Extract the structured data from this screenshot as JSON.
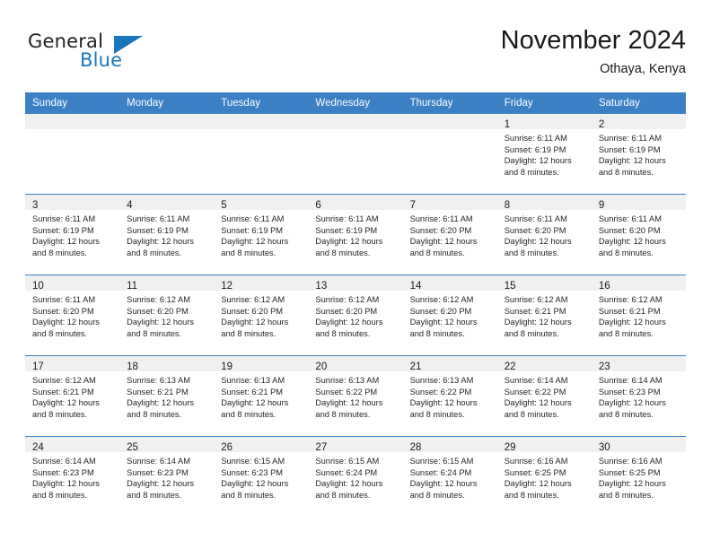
{
  "brand": {
    "name_part1": "General",
    "name_part2": "Blue",
    "triangle_color": "#1b75bb",
    "text_color": "#231f20"
  },
  "header": {
    "title": "November 2024",
    "subtitle": "Othaya, Kenya"
  },
  "colors": {
    "header_bar": "#3b7fc4",
    "daynum_band": "#f0f0f0",
    "grid_line": "#3b7fc4",
    "text": "#1a1a1a"
  },
  "weekday_headers": [
    "Sunday",
    "Monday",
    "Tuesday",
    "Wednesday",
    "Thursday",
    "Friday",
    "Saturday"
  ],
  "weeks": [
    [
      {
        "day": "",
        "empty": true
      },
      {
        "day": "",
        "empty": true
      },
      {
        "day": "",
        "empty": true
      },
      {
        "day": "",
        "empty": true
      },
      {
        "day": "",
        "empty": true
      },
      {
        "day": "1",
        "sunrise": "Sunrise: 6:11 AM",
        "sunset": "Sunset: 6:19 PM",
        "daylight1": "Daylight: 12 hours",
        "daylight2": "and 8 minutes."
      },
      {
        "day": "2",
        "sunrise": "Sunrise: 6:11 AM",
        "sunset": "Sunset: 6:19 PM",
        "daylight1": "Daylight: 12 hours",
        "daylight2": "and 8 minutes."
      }
    ],
    [
      {
        "day": "3",
        "sunrise": "Sunrise: 6:11 AM",
        "sunset": "Sunset: 6:19 PM",
        "daylight1": "Daylight: 12 hours",
        "daylight2": "and 8 minutes."
      },
      {
        "day": "4",
        "sunrise": "Sunrise: 6:11 AM",
        "sunset": "Sunset: 6:19 PM",
        "daylight1": "Daylight: 12 hours",
        "daylight2": "and 8 minutes."
      },
      {
        "day": "5",
        "sunrise": "Sunrise: 6:11 AM",
        "sunset": "Sunset: 6:19 PM",
        "daylight1": "Daylight: 12 hours",
        "daylight2": "and 8 minutes."
      },
      {
        "day": "6",
        "sunrise": "Sunrise: 6:11 AM",
        "sunset": "Sunset: 6:19 PM",
        "daylight1": "Daylight: 12 hours",
        "daylight2": "and 8 minutes."
      },
      {
        "day": "7",
        "sunrise": "Sunrise: 6:11 AM",
        "sunset": "Sunset: 6:20 PM",
        "daylight1": "Daylight: 12 hours",
        "daylight2": "and 8 minutes."
      },
      {
        "day": "8",
        "sunrise": "Sunrise: 6:11 AM",
        "sunset": "Sunset: 6:20 PM",
        "daylight1": "Daylight: 12 hours",
        "daylight2": "and 8 minutes."
      },
      {
        "day": "9",
        "sunrise": "Sunrise: 6:11 AM",
        "sunset": "Sunset: 6:20 PM",
        "daylight1": "Daylight: 12 hours",
        "daylight2": "and 8 minutes."
      }
    ],
    [
      {
        "day": "10",
        "sunrise": "Sunrise: 6:11 AM",
        "sunset": "Sunset: 6:20 PM",
        "daylight1": "Daylight: 12 hours",
        "daylight2": "and 8 minutes."
      },
      {
        "day": "11",
        "sunrise": "Sunrise: 6:12 AM",
        "sunset": "Sunset: 6:20 PM",
        "daylight1": "Daylight: 12 hours",
        "daylight2": "and 8 minutes."
      },
      {
        "day": "12",
        "sunrise": "Sunrise: 6:12 AM",
        "sunset": "Sunset: 6:20 PM",
        "daylight1": "Daylight: 12 hours",
        "daylight2": "and 8 minutes."
      },
      {
        "day": "13",
        "sunrise": "Sunrise: 6:12 AM",
        "sunset": "Sunset: 6:20 PM",
        "daylight1": "Daylight: 12 hours",
        "daylight2": "and 8 minutes."
      },
      {
        "day": "14",
        "sunrise": "Sunrise: 6:12 AM",
        "sunset": "Sunset: 6:20 PM",
        "daylight1": "Daylight: 12 hours",
        "daylight2": "and 8 minutes."
      },
      {
        "day": "15",
        "sunrise": "Sunrise: 6:12 AM",
        "sunset": "Sunset: 6:21 PM",
        "daylight1": "Daylight: 12 hours",
        "daylight2": "and 8 minutes."
      },
      {
        "day": "16",
        "sunrise": "Sunrise: 6:12 AM",
        "sunset": "Sunset: 6:21 PM",
        "daylight1": "Daylight: 12 hours",
        "daylight2": "and 8 minutes."
      }
    ],
    [
      {
        "day": "17",
        "sunrise": "Sunrise: 6:12 AM",
        "sunset": "Sunset: 6:21 PM",
        "daylight1": "Daylight: 12 hours",
        "daylight2": "and 8 minutes."
      },
      {
        "day": "18",
        "sunrise": "Sunrise: 6:13 AM",
        "sunset": "Sunset: 6:21 PM",
        "daylight1": "Daylight: 12 hours",
        "daylight2": "and 8 minutes."
      },
      {
        "day": "19",
        "sunrise": "Sunrise: 6:13 AM",
        "sunset": "Sunset: 6:21 PM",
        "daylight1": "Daylight: 12 hours",
        "daylight2": "and 8 minutes."
      },
      {
        "day": "20",
        "sunrise": "Sunrise: 6:13 AM",
        "sunset": "Sunset: 6:22 PM",
        "daylight1": "Daylight: 12 hours",
        "daylight2": "and 8 minutes."
      },
      {
        "day": "21",
        "sunrise": "Sunrise: 6:13 AM",
        "sunset": "Sunset: 6:22 PM",
        "daylight1": "Daylight: 12 hours",
        "daylight2": "and 8 minutes."
      },
      {
        "day": "22",
        "sunrise": "Sunrise: 6:14 AM",
        "sunset": "Sunset: 6:22 PM",
        "daylight1": "Daylight: 12 hours",
        "daylight2": "and 8 minutes."
      },
      {
        "day": "23",
        "sunrise": "Sunrise: 6:14 AM",
        "sunset": "Sunset: 6:23 PM",
        "daylight1": "Daylight: 12 hours",
        "daylight2": "and 8 minutes."
      }
    ],
    [
      {
        "day": "24",
        "sunrise": "Sunrise: 6:14 AM",
        "sunset": "Sunset: 6:23 PM",
        "daylight1": "Daylight: 12 hours",
        "daylight2": "and 8 minutes."
      },
      {
        "day": "25",
        "sunrise": "Sunrise: 6:14 AM",
        "sunset": "Sunset: 6:23 PM",
        "daylight1": "Daylight: 12 hours",
        "daylight2": "and 8 minutes."
      },
      {
        "day": "26",
        "sunrise": "Sunrise: 6:15 AM",
        "sunset": "Sunset: 6:23 PM",
        "daylight1": "Daylight: 12 hours",
        "daylight2": "and 8 minutes."
      },
      {
        "day": "27",
        "sunrise": "Sunrise: 6:15 AM",
        "sunset": "Sunset: 6:24 PM",
        "daylight1": "Daylight: 12 hours",
        "daylight2": "and 8 minutes."
      },
      {
        "day": "28",
        "sunrise": "Sunrise: 6:15 AM",
        "sunset": "Sunset: 6:24 PM",
        "daylight1": "Daylight: 12 hours",
        "daylight2": "and 8 minutes."
      },
      {
        "day": "29",
        "sunrise": "Sunrise: 6:16 AM",
        "sunset": "Sunset: 6:25 PM",
        "daylight1": "Daylight: 12 hours",
        "daylight2": "and 8 minutes."
      },
      {
        "day": "30",
        "sunrise": "Sunrise: 6:16 AM",
        "sunset": "Sunset: 6:25 PM",
        "daylight1": "Daylight: 12 hours",
        "daylight2": "and 8 minutes."
      }
    ]
  ]
}
